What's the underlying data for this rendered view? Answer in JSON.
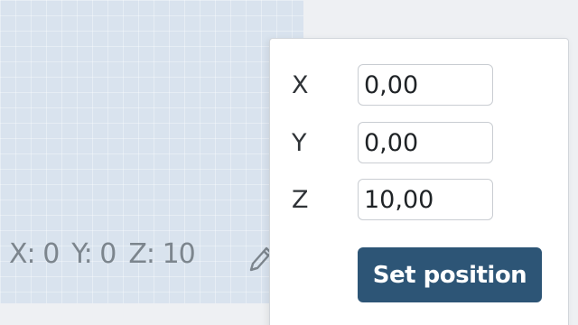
{
  "readout": {
    "x": "X: 0",
    "y": "Y: 0",
    "z": "Z: 10"
  },
  "position_popup": {
    "fields": [
      {
        "label": "X",
        "value": "0,00"
      },
      {
        "label": "Y",
        "value": "0,00"
      },
      {
        "label": "Z",
        "value": "10,00"
      }
    ],
    "submit_label": "Set position"
  },
  "icons": {
    "edit": "pencil-icon"
  },
  "colors": {
    "viewport_background": "#d9e3ee",
    "button_primary": "#2d5576",
    "readout_text": "#7c858d"
  }
}
